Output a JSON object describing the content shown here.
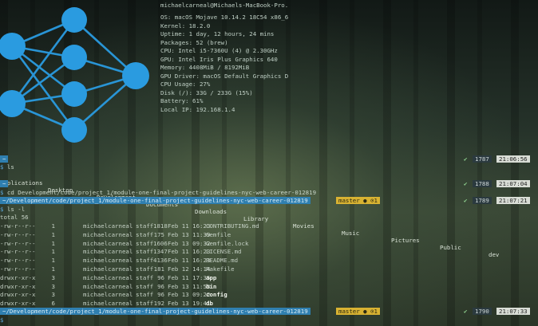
{
  "sysinfo": {
    "user_host": "michaelcarneal@Michaels-MacBook-Pro.",
    "lines": [
      "OS: macOS Mojave 10.14.2 18C54 x86_6",
      "Kernel: 18.2.0",
      "Uptime: 1 day, 12 hours, 24 mins",
      "Packages: 52 (brew)",
      "CPU: Intel i5-7360U (4) @ 2.30GHz",
      "GPU: Intel Iris Plus Graphics 640",
      "Memory: 4408MiB / 8192MiB",
      "GPU Driver: macOS Default Graphics D",
      "CPU Usage: 27%",
      "Disk (/): 33G / 233G (15%)",
      "Battery: 61%",
      "Local IP: 192.168.1.4"
    ]
  },
  "prompts": [
    {
      "path": "~",
      "command": "ls",
      "count": "1787",
      "time": "21:06:56"
    },
    {
      "path": "~",
      "command": "cd Development/code/project_1/module-one-final-project-guidelines-nyc-web-career-012819",
      "count": "1788",
      "time": "21:07:04"
    },
    {
      "path": "~/Development/code/project_1/module-one-final-project-guidelines-nyc-web-career-012819",
      "branch": "master ● ⊙1",
      "command": "ls -l",
      "count": "1789",
      "time": "21:07:21"
    },
    {
      "path": "~/Development/code/project_1/module-one-final-project-guidelines-nyc-web-career-012819",
      "branch": "master ● ⊙1",
      "command": "",
      "count": "1790",
      "time": "21:07:33"
    }
  ],
  "ls_output": [
    "Applications",
    "Desktop",
    "Development",
    "Documents",
    "Downloads",
    "Library",
    "Movies",
    "Music",
    "Pictures",
    "Public",
    "dev"
  ],
  "ls_l": {
    "total": "total 56",
    "rows": [
      [
        "-rw-r--r--",
        "1",
        "michaelcarneal",
        "staff",
        "1818",
        "Feb 11 16:23",
        "CONTRIBUTING.md"
      ],
      [
        "-rw-r--r--",
        "1",
        "michaelcarneal",
        "staff",
        "175",
        "Feb 13 11:39",
        "Gemfile"
      ],
      [
        "-rw-r--r--",
        "1",
        "michaelcarneal",
        "staff",
        "1606",
        "Feb 13 09:32",
        "Gemfile.lock"
      ],
      [
        "-rw-r--r--",
        "1",
        "michaelcarneal",
        "staff",
        "1347",
        "Feb 11 16:23",
        "LICENSE.md"
      ],
      [
        "-rw-r--r--",
        "1",
        "michaelcarneal",
        "staff",
        "4136",
        "Feb 11 16:23",
        "README.md"
      ],
      [
        "-rw-r--r--",
        "1",
        "michaelcarneal",
        "staff",
        "181",
        "Feb 12 14:14",
        "Rakefile"
      ],
      [
        "drwxr-xr-x",
        "3",
        "michaelcarneal",
        "staff",
        "96",
        "Feb 11 17:35",
        "app"
      ],
      [
        "drwxr-xr-x",
        "3",
        "michaelcarneal",
        "staff",
        "96",
        "Feb 13 11:53",
        "bin"
      ],
      [
        "drwxr-xr-x",
        "3",
        "michaelcarneal",
        "staff",
        "96",
        "Feb 13 09:22",
        "config"
      ],
      [
        "drwxr-xr-x",
        "6",
        "michaelcarneal",
        "staff",
        "192",
        "Feb 13 19:41",
        "db"
      ],
      [
        "drwxr-xr-x",
        "6",
        "michaelcarneal",
        "staff",
        "192",
        "Feb 13 17:52",
        "lib"
      ]
    ]
  },
  "colors": {
    "path": "#2f7fb0",
    "branch": "#d8b232",
    "neural_node": "#2a9be0"
  },
  "icons": {
    "check": "✔",
    "prompt": "$"
  }
}
